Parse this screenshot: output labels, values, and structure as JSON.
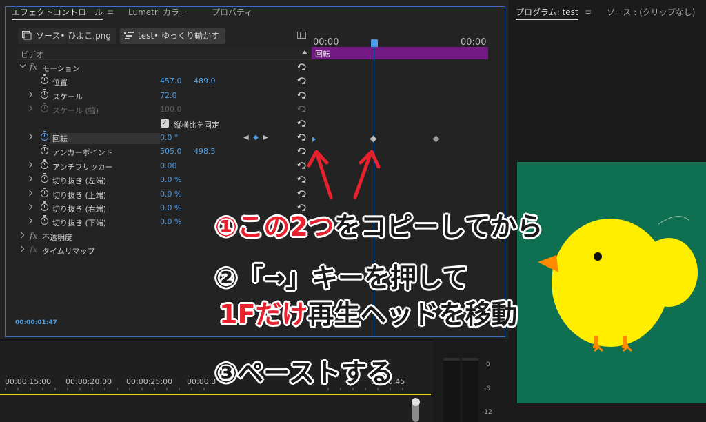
{
  "effect_controls": {
    "tabs": [
      {
        "label": "エフェクトコントロール",
        "active": true
      },
      {
        "label": "Lumetri カラー"
      },
      {
        "label": "プロパティ"
      }
    ],
    "tab_menu_icon": "≡",
    "source_clip_label": "ソース• ひよこ.png",
    "sequence_clip_label": "test• ゆっくり動かす",
    "section_label": "ビデオ",
    "properties": [
      {
        "name": "モーション",
        "fx": true,
        "expanded": true
      },
      {
        "name": "位置",
        "value": "457.0",
        "value2": "489.0"
      },
      {
        "name": "スケール",
        "value": "72.0"
      },
      {
        "name": "スケール (幅)",
        "value": "100.0",
        "disabled": true
      },
      {
        "name": "縦横比を固定",
        "checkbox": true
      },
      {
        "name": "回転",
        "value": "0.0 °",
        "keyframed": true
      },
      {
        "name": "アンカーポイント",
        "value": "505.0",
        "value2": "498.5"
      },
      {
        "name": "アンチフリッカー",
        "value": "0.00"
      },
      {
        "name": "切り抜き (左端)",
        "value": "0.0 %"
      },
      {
        "name": "切り抜き (上端)",
        "value": "0.0 %"
      },
      {
        "name": "切り抜き (右端)",
        "value": "0.0 %"
      },
      {
        "name": "切り抜き (下端)",
        "value": "0.0 %"
      },
      {
        "name": "不透明度",
        "fx": true
      },
      {
        "name": "タイムリマップ",
        "fx": true,
        "fx_dim": true
      }
    ],
    "keyframe_nav": {
      "prev": "◀",
      "add": "◆",
      "next": "▶"
    },
    "timecode": "00:00:01:47",
    "ruler_start": "00:00",
    "ruler_end": "00:00",
    "clip_bar_label": "回転",
    "clip_bar_color": "#741a84",
    "accent_color": "#4c9ee8"
  },
  "program_monitor": {
    "tab_label": "プログラム: test",
    "menu_icon": "≡",
    "source_label": "ソース : (クリップなし)",
    "background_color": "#0f6f51"
  },
  "timeline": {
    "ticks": [
      "00:00:15:00",
      "00:00:20:00",
      "00:00:25:00",
      "00:00:3",
      "00:00:45"
    ],
    "meter_labels": [
      "0",
      "-6",
      "-12"
    ]
  },
  "annotations": {
    "step1_num": "①",
    "step1_red": "この2つ",
    "step1_rest": "をコピーしてから",
    "step2_line1": "②「→」キーを押して",
    "step2_red": "1Fだけ",
    "step2_rest": "再生ヘッドを移動",
    "step3": "③ペーストする"
  }
}
